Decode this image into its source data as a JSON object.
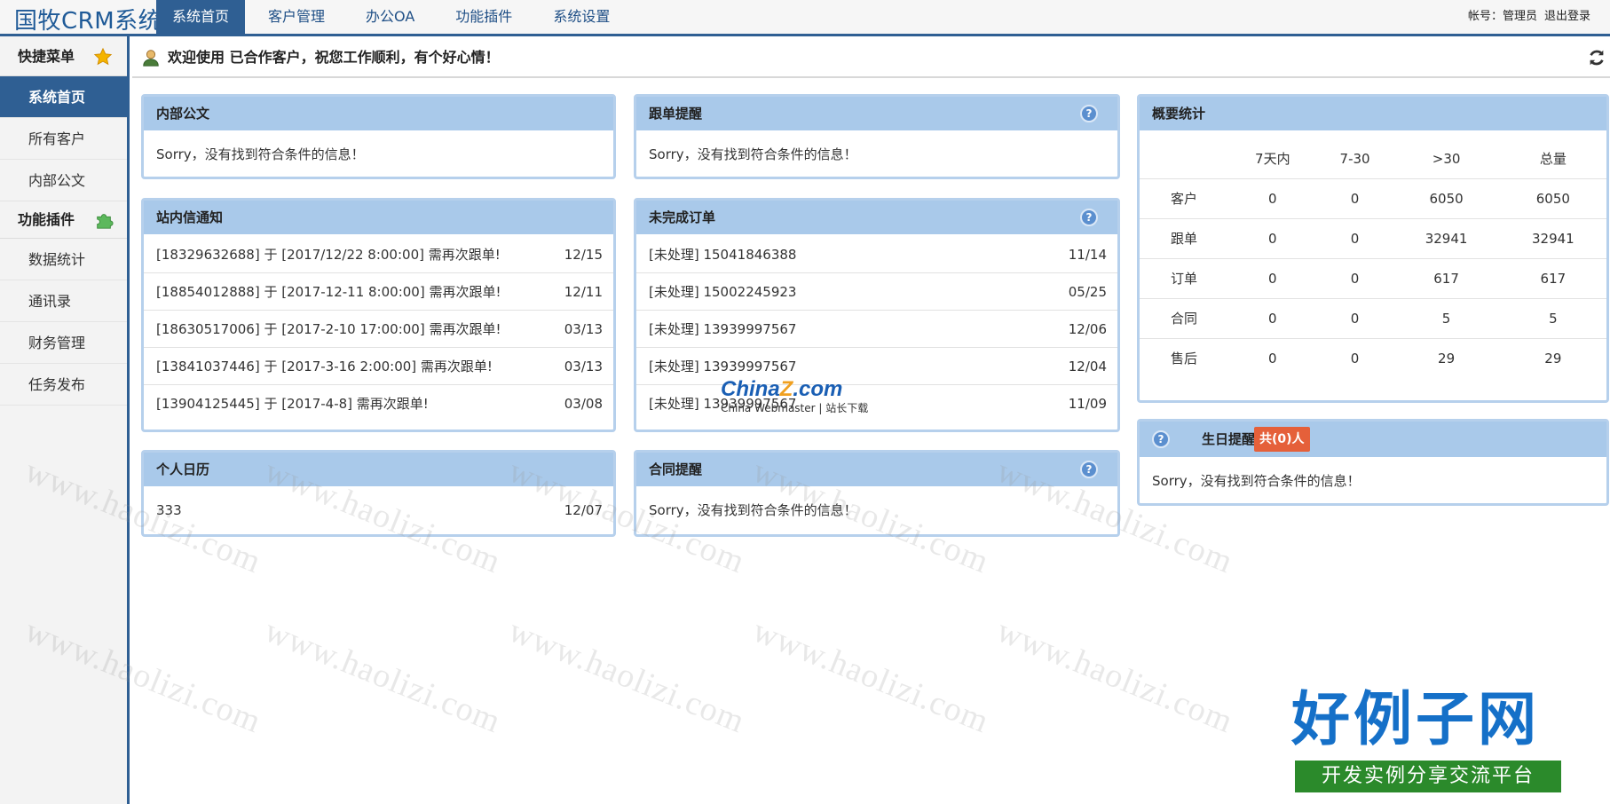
{
  "app": {
    "logo": "国牧CRM系统",
    "nav": [
      "系统首页",
      "客户管理",
      "办公OA",
      "功能插件",
      "系统设置"
    ],
    "account_label": "帐号：管理员",
    "logout_label": "退出登录"
  },
  "sidebar": {
    "quick_menu": "快捷菜单",
    "quick_items": [
      "系统首页",
      "所有客户",
      "内部公文"
    ],
    "plugins": "功能插件",
    "plugin_items": [
      "数据统计",
      "通讯录",
      "财务管理",
      "任务发布"
    ]
  },
  "welcome": "欢迎使用 已合作客户，祝您工作顺利，有个好心情！",
  "panels": {
    "internal_doc": {
      "title": "内部公文",
      "empty": "Sorry，没有找到符合条件的信息！"
    },
    "followup": {
      "title": "跟单提醒",
      "empty": "Sorry，没有找到符合条件的信息！"
    },
    "messages": {
      "title": "站内信通知",
      "rows": [
        {
          "text": "[18329632688] 于 [2017/12/22 8:00:00] 需再次跟单!",
          "date": "12/15"
        },
        {
          "text": "[18854012888] 于 [2017-12-11 8:00:00] 需再次跟单!",
          "date": "12/11"
        },
        {
          "text": "[18630517006] 于 [2017-2-10 17:00:00] 需再次跟单!",
          "date": "03/13"
        },
        {
          "text": "[13841037446] 于 [2017-3-16 2:00:00] 需再次跟单!",
          "date": "03/13"
        },
        {
          "text": "[13904125445] 于 [2017-4-8] 需再次跟单!",
          "date": "03/08"
        }
      ]
    },
    "orders": {
      "title": "未完成订单",
      "rows": [
        {
          "text": "[未处理] 15041846388",
          "date": "11/14"
        },
        {
          "text": "[未处理] 15002245923",
          "date": "05/25"
        },
        {
          "text": "[未处理] 13939997567",
          "date": "12/06"
        },
        {
          "text": "[未处理] 13939997567",
          "date": "12/04"
        },
        {
          "text": "[未处理] 13939997567",
          "date": "11/09"
        }
      ]
    },
    "calendar": {
      "title": "个人日历",
      "rows": [
        {
          "text": "333",
          "date": "12/07"
        }
      ]
    },
    "contract": {
      "title": "合同提醒",
      "empty": "Sorry，没有找到符合条件的信息！"
    },
    "stats": {
      "title": "概要统计",
      "columns": [
        "",
        "7天内",
        "7-30",
        ">30",
        "总量"
      ],
      "rows": [
        [
          "客户",
          "0",
          "0",
          "6050",
          "6050"
        ],
        [
          "跟单",
          "0",
          "0",
          "32941",
          "32941"
        ],
        [
          "订单",
          "0",
          "0",
          "617",
          "617"
        ],
        [
          "合同",
          "0",
          "0",
          "5",
          "5"
        ],
        [
          "售后",
          "0",
          "0",
          "29",
          "29"
        ]
      ]
    },
    "birthday": {
      "title": "生日提醒",
      "badge": "共(0)人",
      "empty": "Sorry，没有找到符合条件的信息！"
    }
  },
  "help_glyph": "?",
  "watermark": "www.haolizi.com",
  "china_logo": {
    "main": "China",
    "z": "Z",
    "suffix": ".com",
    "sub": "China Webmaster | 站长下载"
  },
  "brand": {
    "title": "好例子网",
    "subtitle": "开发实例分享交流平台"
  }
}
